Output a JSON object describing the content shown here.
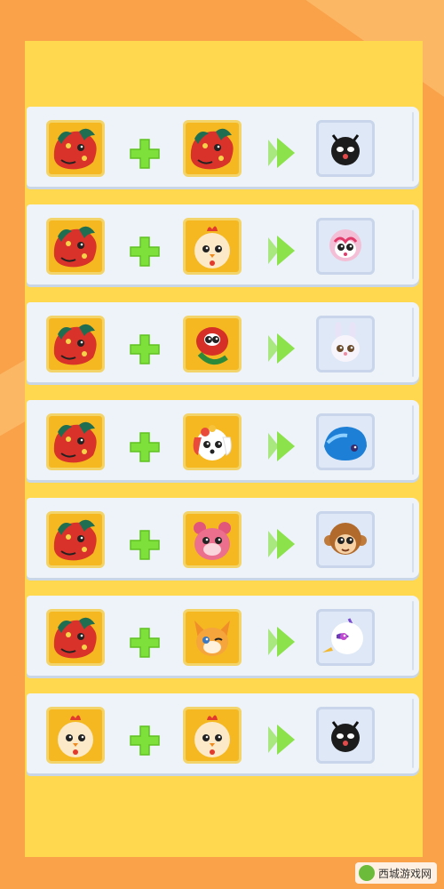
{
  "watermark": {
    "text": "西城游戏网"
  },
  "combos": [
    {
      "left": "carp-pet-icon",
      "right": "carp-pet-icon",
      "result": "black-spirit-pet-icon"
    },
    {
      "left": "carp-pet-icon",
      "right": "chick-pet-icon",
      "result": "pink-opera-monkey-pet-icon"
    },
    {
      "left": "carp-pet-icon",
      "right": "red-snake-pet-icon",
      "result": "white-rabbit-pet-icon"
    },
    {
      "left": "carp-pet-icon",
      "right": "opera-dog-pet-icon",
      "result": "blue-whale-pet-icon"
    },
    {
      "left": "carp-pet-icon",
      "right": "pink-hamster-pet-icon",
      "result": "monkey-pet-icon"
    },
    {
      "left": "carp-pet-icon",
      "right": "fox-pet-icon",
      "result": "white-swan-pet-icon"
    },
    {
      "left": "chick-pet-icon",
      "right": "chick-pet-icon",
      "result": "black-spirit-pet-icon"
    }
  ],
  "colors": {
    "plus": "#7ee03a",
    "arrow": "#8be24a",
    "panel": "#ffd84f",
    "background": "#f9a24a"
  }
}
